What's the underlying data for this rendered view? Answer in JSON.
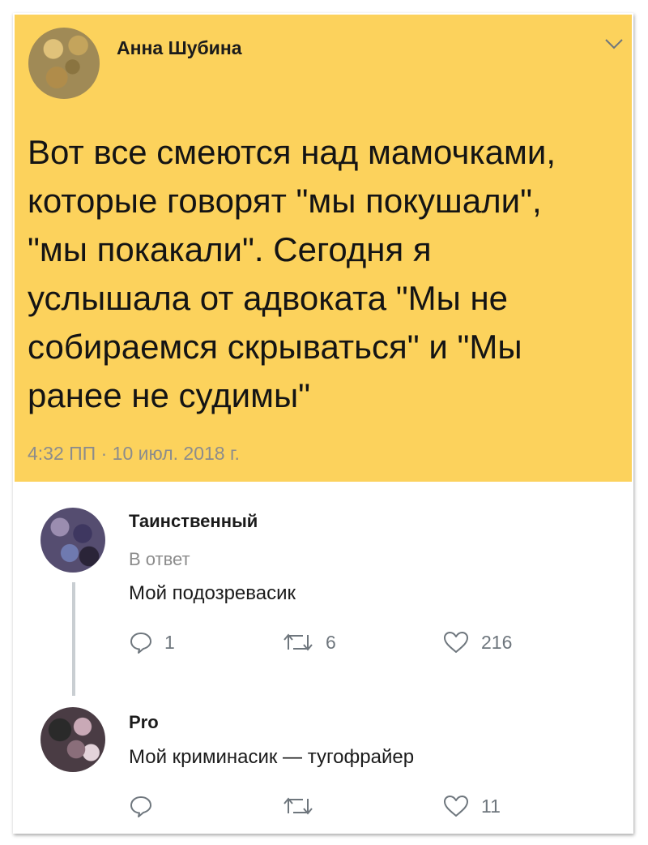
{
  "main_tweet": {
    "author": "Анна Шубина",
    "lines": [
      "Вот все смеются над мамочками,",
      "которые говорят \"мы покушали\",",
      "\"мы покакали\". Сегодня я",
      "услышала от адвоката \"Мы не",
      "собираемся скрываться\" и \"Мы",
      "ранее не судимы\""
    ],
    "timestamp": "4:32 ПП · 10 июл. 2018 г."
  },
  "replies": [
    {
      "author": "Таинственный",
      "meta": "В ответ",
      "text": "Мой подозревасик",
      "replies_count": "1",
      "retweets_count": "6",
      "likes_count": "216"
    },
    {
      "author": "Pro",
      "text": "Мой криминасик — тугофрайер",
      "replies_count": "",
      "retweets_count": "",
      "likes_count": "11"
    }
  ],
  "colors": {
    "highlight": "#fcd25c",
    "icon": "#6e767d",
    "thread_line": "#c9ced2"
  },
  "icons": {
    "reply": "speech-bubble-icon",
    "retweet": "retweet-icon",
    "like": "heart-icon",
    "menu": "chevron-down-icon"
  }
}
